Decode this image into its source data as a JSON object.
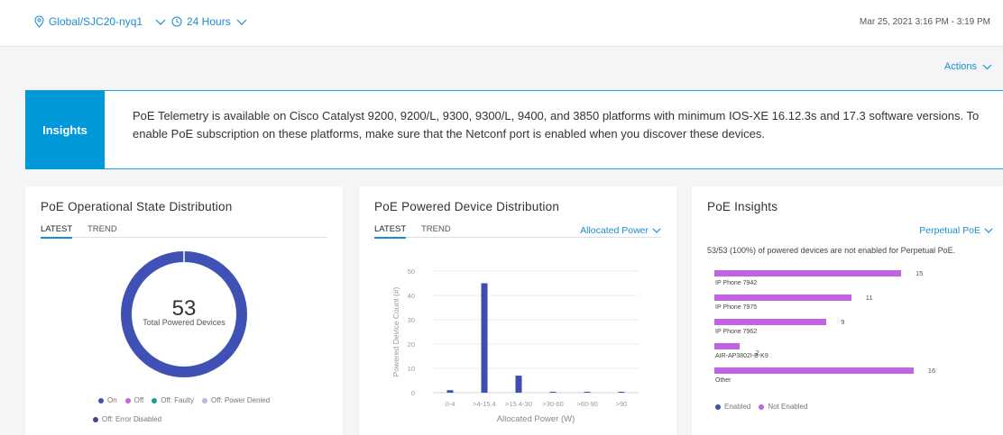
{
  "header": {
    "location": "Global/SJC20-nyq1",
    "time_range": "24 Hours",
    "date_range": "Mar 25, 2021 3:16 PM - 3:19 PM"
  },
  "actions_label": "Actions",
  "insights_banner": {
    "badge": "Insights",
    "message": "PoE Telemetry is available on Cisco Catalyst 9200, 9200/L, 9300, 9300/L, 9400, and 3850 platforms with minimum IOS-XE 16.12.3s and 17.3 software versions. To enable PoE subscription on these platforms, make sure that the Netconf port is enabled when you discover these devices."
  },
  "card_operational": {
    "title": "PoE Operational State Distribution",
    "tabs": [
      "LATEST",
      "TREND"
    ],
    "total": "53",
    "total_label": "Total Powered Devices",
    "legend": [
      {
        "label": "On",
        "color": "#3f51b5"
      },
      {
        "label": "Off",
        "color": "#c263e3"
      },
      {
        "label": "Off: Faulty",
        "color": "#1a9c9c"
      },
      {
        "label": "Off: Power Denied",
        "color": "#b9b3e6"
      },
      {
        "label": "Off: Error Disabled",
        "color": "#5a3d8c"
      }
    ]
  },
  "card_powered": {
    "title": "PoE Powered Device Distribution",
    "tabs": [
      "LATEST",
      "TREND"
    ],
    "dropdown": "Allocated Power"
  },
  "card_insights": {
    "title": "PoE Insights",
    "dropdown": "Perpetual PoE",
    "summary": "53/53 (100%) of powered devices are not enabled for Perpetual PoE.",
    "bars": [
      {
        "label": "IP Phone 7942",
        "value": 15
      },
      {
        "label": "IP Phone 7975",
        "value": 11
      },
      {
        "label": "IP Phone 7962",
        "value": 9
      },
      {
        "label": "AIR-AP3802I-B-K9",
        "value": 2
      },
      {
        "label": "Other",
        "value": 16
      }
    ],
    "bar_color": "#c263e3",
    "legend": [
      {
        "label": "Enabled",
        "color": "#3f51b5"
      },
      {
        "label": "Not Enabled",
        "color": "#c263e3"
      }
    ]
  },
  "chart_data": {
    "type": "bar",
    "categories": [
      "0-4",
      ">4-15.4",
      ">15.4-30",
      ">30-60",
      ">60-90",
      ">90"
    ],
    "values": [
      1,
      45,
      7,
      0,
      0,
      0
    ],
    "xlabel": "Allocated Power (W)",
    "ylabel": "Powered Device Count (#)",
    "ylim": [
      0,
      50
    ],
    "yticks": [
      0,
      10,
      20,
      30,
      40,
      50
    ],
    "grid": true,
    "color": "#3d4db5"
  }
}
